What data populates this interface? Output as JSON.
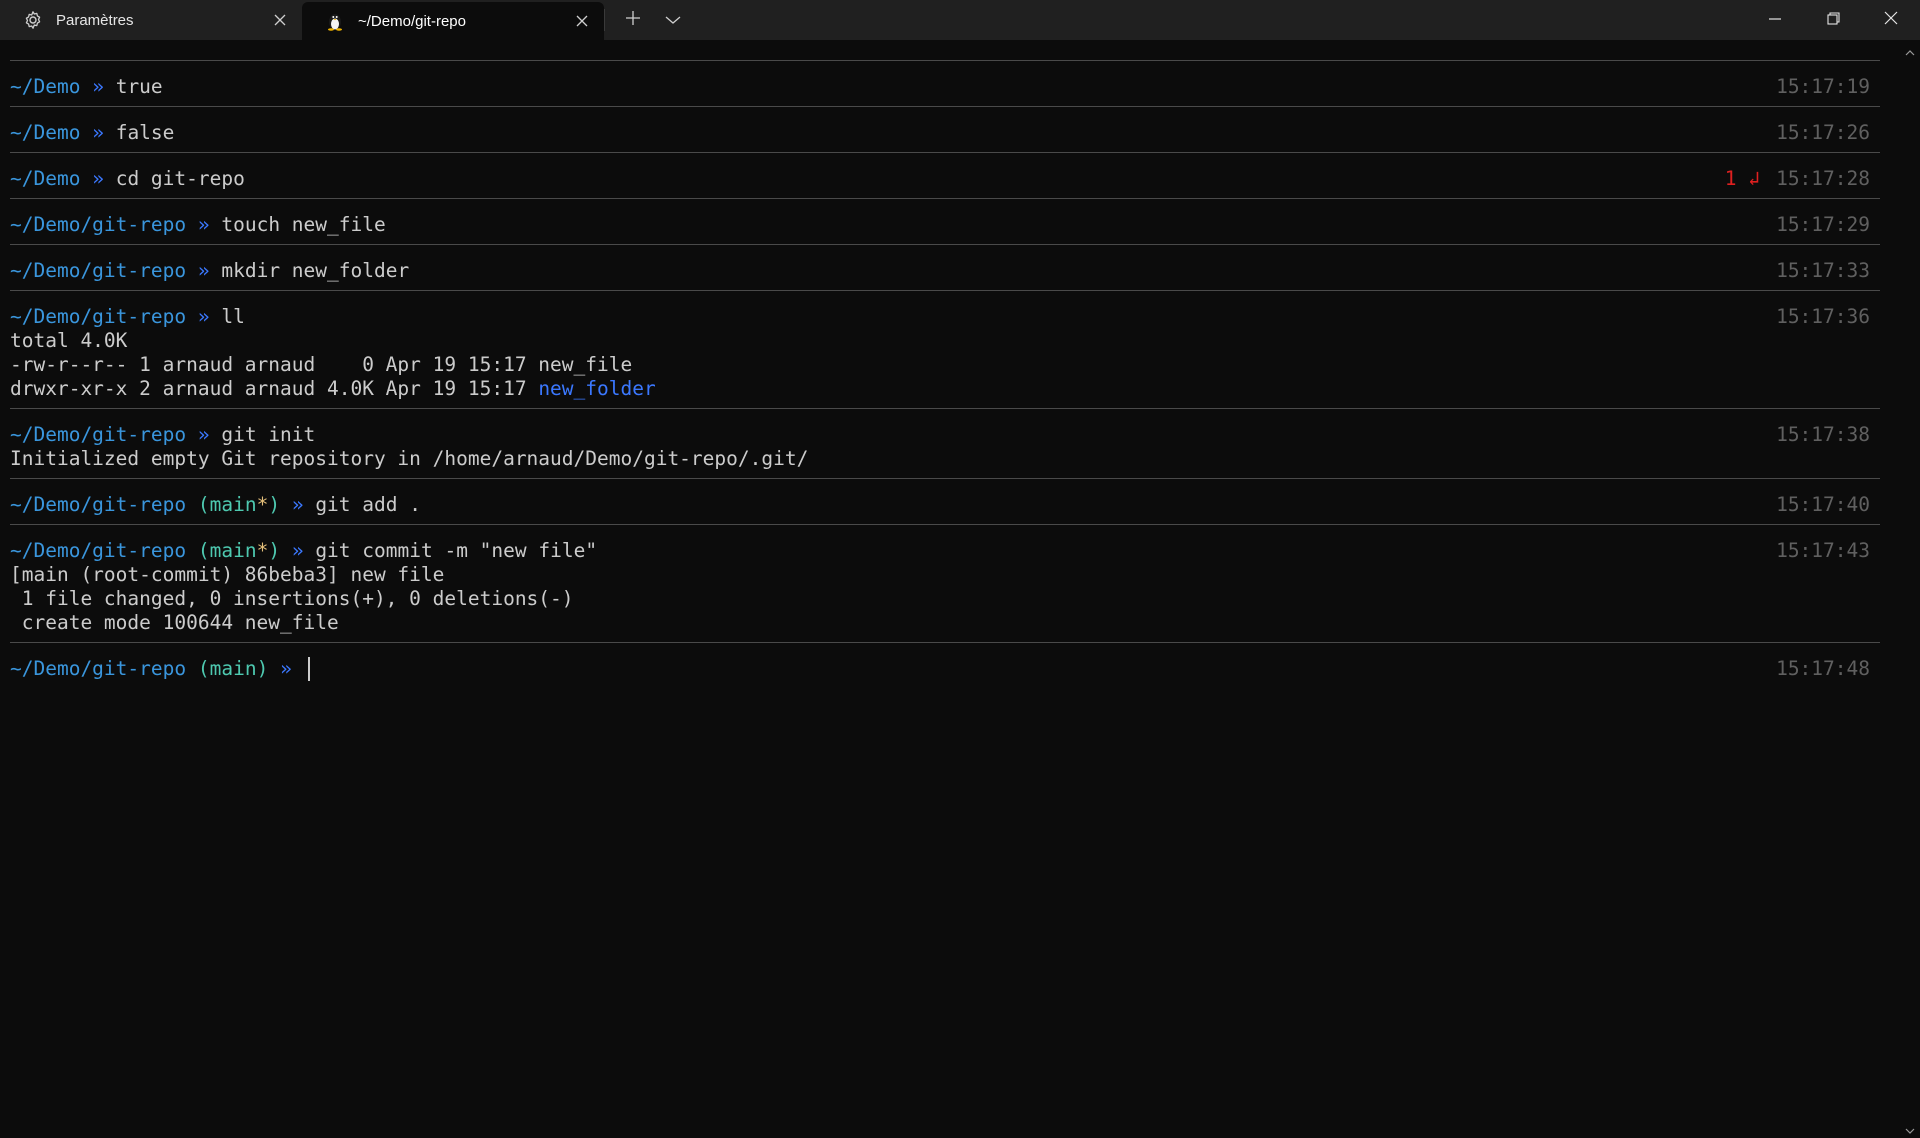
{
  "tabs": [
    {
      "title": "Paramètres",
      "icon": "gear-icon",
      "active": false
    },
    {
      "title": "~/Demo/git-repo",
      "icon": "linux-penguin-icon",
      "active": true
    }
  ],
  "window_controls": [
    "minimize",
    "restore",
    "close"
  ],
  "colors": {
    "background": "#0c0c0c",
    "titlebar": "#202020",
    "path": "#3a96dd",
    "arrow": "#3b78ff",
    "branch": "#4ec9b0",
    "dirty_marker": "#e5c07b",
    "error": "#e02020",
    "timestamp": "#606060"
  },
  "terminal": {
    "blocks": [
      {
        "path": "~/Demo",
        "arrow": "»",
        "command": "true",
        "time": "15:17:19",
        "output": []
      },
      {
        "path": "~/Demo",
        "arrow": "»",
        "command": "false",
        "time": "15:17:26",
        "output": []
      },
      {
        "path": "~/Demo",
        "arrow": "»",
        "command": "cd git-repo",
        "time": "15:17:28",
        "exit_code": "1 ↲",
        "output": []
      },
      {
        "path": "~/Demo/git-repo",
        "arrow": "»",
        "command": "touch new_file",
        "time": "15:17:29",
        "output": []
      },
      {
        "path": "~/Demo/git-repo",
        "arrow": "»",
        "command": "mkdir new_folder",
        "time": "15:17:33",
        "output": []
      },
      {
        "path": "~/Demo/git-repo",
        "arrow": "»",
        "command": "ll",
        "time": "15:17:36",
        "output": [
          "total 4.0K",
          "-rw-r--r-- 1 arnaud arnaud    0 Apr 19 15:17 new_file",
          "drwxr-xr-x 2 arnaud arnaud 4.0K Apr 19 15:17 ",
          "new_folder"
        ]
      },
      {
        "path": "~/Demo/git-repo",
        "arrow": "»",
        "command": "git init",
        "time": "15:17:38",
        "output": [
          "Initialized empty Git repository in /home/arnaud/Demo/git-repo/.git/"
        ]
      },
      {
        "path": "~/Demo/git-repo",
        "branch_open": " (",
        "branch": "main",
        "dirty": "*",
        "branch_close": ")",
        "arrow": "»",
        "command": "git add .",
        "time": "15:17:40",
        "output": []
      },
      {
        "path": "~/Demo/git-repo",
        "branch_open": " (",
        "branch": "main",
        "dirty": "*",
        "branch_close": ")",
        "arrow": "»",
        "command": "git commit -m \"new file\"",
        "time": "15:17:43",
        "output": [
          "[main (root-commit) 86beba3] new file",
          " 1 file changed, 0 insertions(+), 0 deletions(-)",
          " create mode 100644 new_file"
        ]
      },
      {
        "path": "~/Demo/git-repo",
        "branch_open": " (",
        "branch": "main",
        "branch_close": ")",
        "arrow": "»",
        "command": "",
        "time": "15:17:48",
        "output": []
      }
    ]
  }
}
